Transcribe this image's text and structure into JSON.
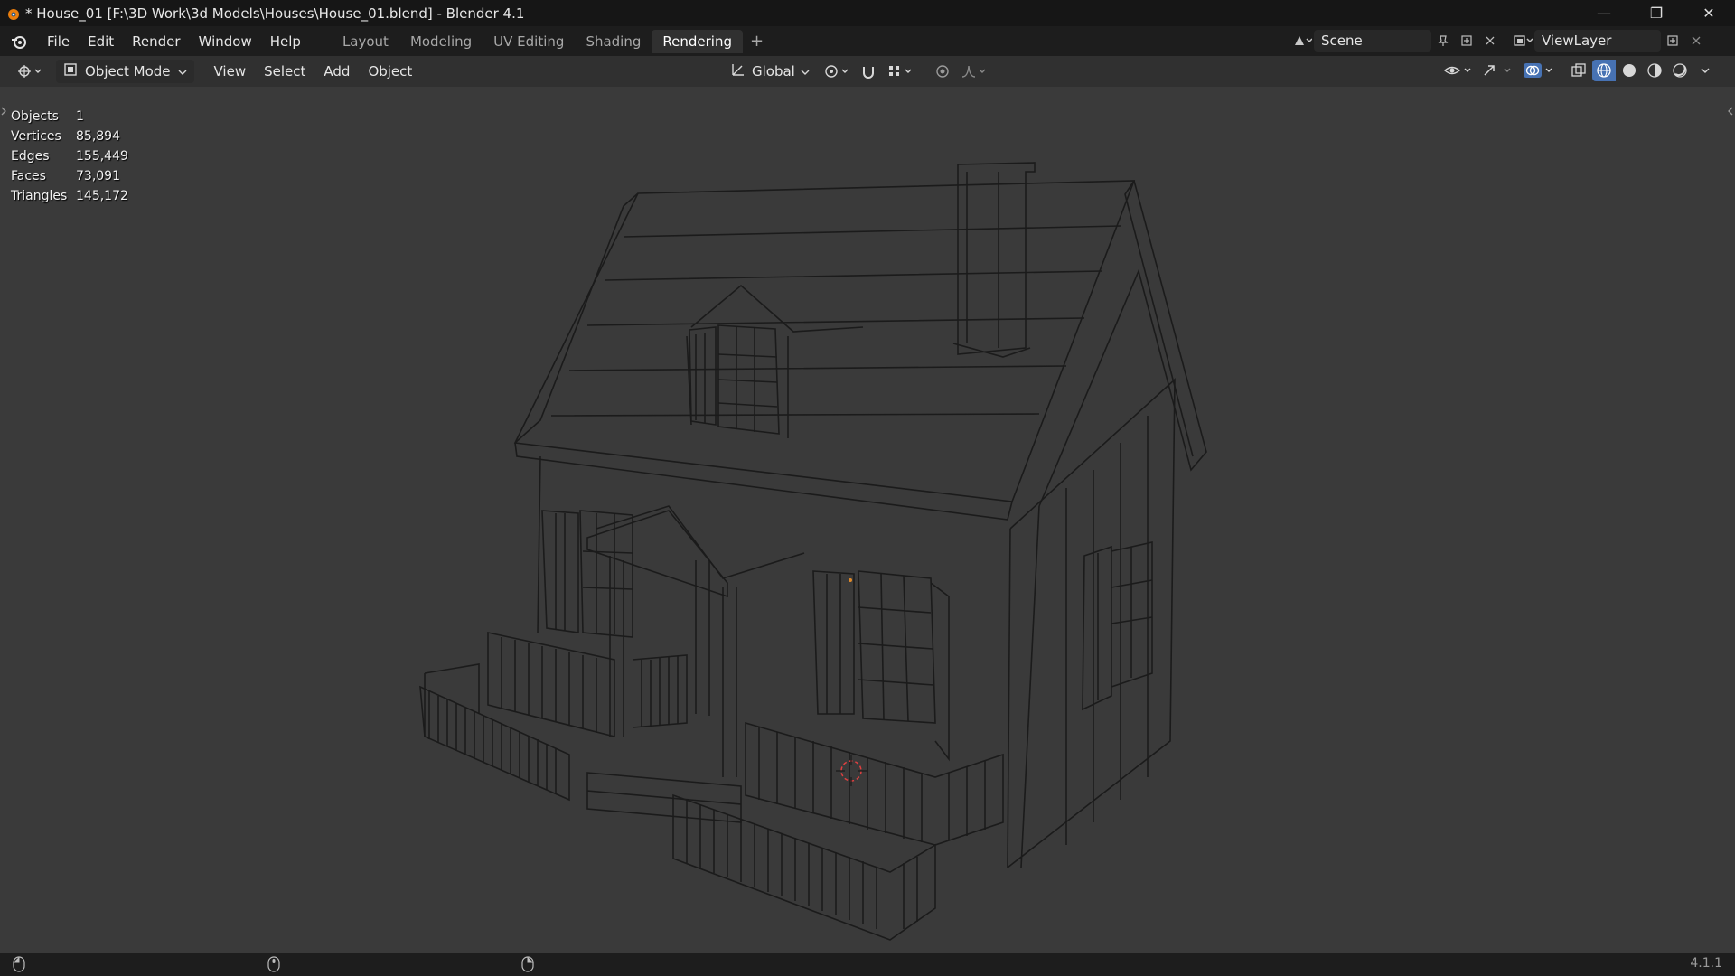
{
  "window": {
    "title": "* House_01 [F:\\3D Work\\3d Models\\Houses\\House_01.blend] - Blender 4.1",
    "controls": {
      "minimize": "—",
      "maximize": "❐",
      "close": "✕"
    }
  },
  "menus": [
    "File",
    "Edit",
    "Render",
    "Window",
    "Help"
  ],
  "workspaces": [
    "Layout",
    "Modeling",
    "UV Editing",
    "Shading",
    "Rendering"
  ],
  "active_workspace": "Rendering",
  "add_workspace": "+",
  "scene": {
    "name": "Scene",
    "view_layer": "ViewLayer"
  },
  "viewport_header": {
    "mode": "Object Mode",
    "menus": [
      "View",
      "Select",
      "Add",
      "Object"
    ],
    "transform_orientation": "Global"
  },
  "stats": [
    {
      "label": "Objects",
      "value": "1"
    },
    {
      "label": "Vertices",
      "value": "85,894"
    },
    {
      "label": "Edges",
      "value": "155,449"
    },
    {
      "label": "Faces",
      "value": "73,091"
    },
    {
      "label": "Triangles",
      "value": "145,172"
    }
  ],
  "colors": {
    "titlebar": "#161616",
    "topbar": "#1d1d1d",
    "viewport": "#3a3a3a",
    "wire": "#1a1a1a",
    "accent": "#4772b3",
    "cursor": "#e04040"
  },
  "status": {
    "version": "4.1.1"
  }
}
